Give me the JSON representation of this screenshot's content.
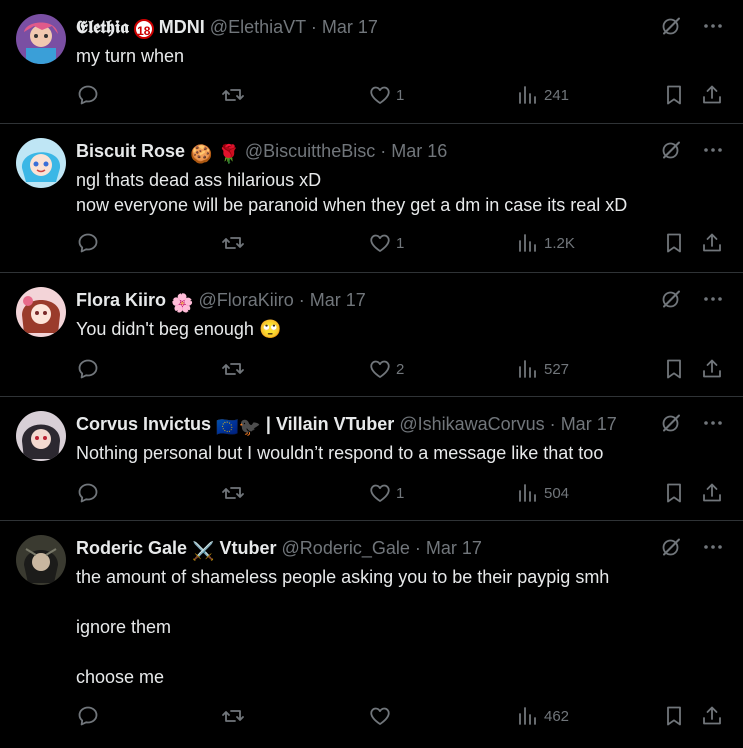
{
  "tweets": [
    {
      "name": "𝕰𝖑𝖊𝖙𝖍𝖎𝖆",
      "badge": "18",
      "name_suffix": "MDNI",
      "handle": "@ElethiaVT",
      "date": "Mar 17",
      "text": "my turn when",
      "likes": "1",
      "views": "241"
    },
    {
      "name": "Biscuit Rose",
      "emoji": "🍪 🌹",
      "handle": "@BiscuittheBisc",
      "date": "Mar 16",
      "text": "ngl thats dead ass hilarious xD\nnow everyone will be paranoid when they get a dm in case its real xD",
      "likes": "1",
      "views": "1.2K"
    },
    {
      "name": "Flora Kiiro",
      "emoji": "🌸",
      "handle": "@FloraKiiro",
      "date": "Mar 17",
      "text": "You didn't beg enough 🙄",
      "likes": "2",
      "views": "527"
    },
    {
      "name": "Corvus Invictus",
      "emoji": "🇪🇺🐦‍⬛",
      "name_suffix": "| Villain VTuber",
      "handle": "@IshikawaCorvus",
      "date": "Mar 17",
      "text": "Nothing personal but I wouldn’t respond to a message like that too",
      "likes": "1",
      "views": "504"
    },
    {
      "name": "Roderic Gale",
      "emoji": "⚔️",
      "name_suffix": "Vtuber",
      "handle": "@Roderic_Gale",
      "date": "Mar 17",
      "text": "the amount of shameless people asking you to be their paypig smh\n\nignore them\n\nchoose me",
      "likes": "",
      "views": "462"
    }
  ],
  "separator": "·",
  "icons": [
    "reply-icon",
    "retweet-icon",
    "like-icon",
    "views-icon",
    "bookmark-icon",
    "share-icon",
    "grok-icon",
    "more-icon"
  ]
}
